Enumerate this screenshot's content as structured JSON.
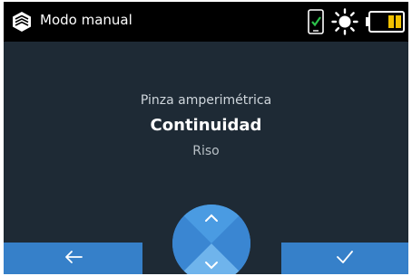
{
  "colors": {
    "screen_bg": "#1e2a35",
    "status_bar_bg": "#000000",
    "accent_blue": "#3680c9",
    "dial_blue": "#3f8fdc",
    "dial_light_blue": "#6fb4ec",
    "battery_fill": "#f2c200",
    "check_green": "#2cc14a"
  },
  "status_bar": {
    "title": "Modo manual",
    "icons": [
      "app-logo-icon",
      "phone-connected-icon",
      "brightness-icon",
      "battery-icon"
    ]
  },
  "main": {
    "subtitle": "Pinza amperimétrica",
    "mode": "Continuidad",
    "secondary": "Riso"
  },
  "footer": {
    "back_icon": "arrow-left-icon",
    "confirm_icon": "check-icon",
    "dial_up_icon": "chevron-up-icon",
    "dial_down_icon": "chevron-down-icon"
  }
}
